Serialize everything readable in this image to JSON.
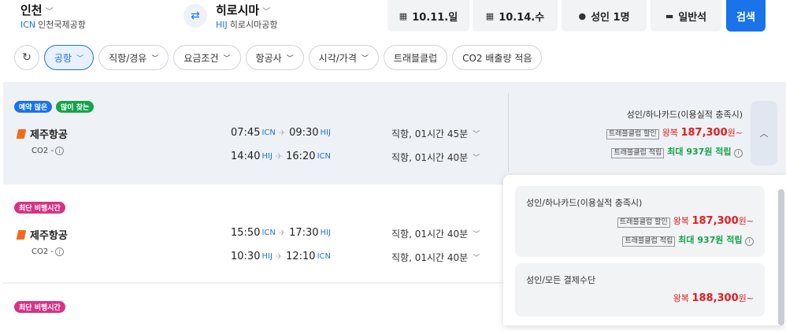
{
  "header": {
    "origin": {
      "city": "인천",
      "code": "ICN",
      "airport": "인천국제공항"
    },
    "destination": {
      "city": "히로시마",
      "code": "HIJ",
      "airport": "히로시마공항"
    },
    "depart_date": "10.11.일",
    "return_date": "10.14.수",
    "passengers": "성인 1명",
    "cabin": "일반석",
    "search_label": "검색"
  },
  "filters": [
    {
      "label": "공항"
    },
    {
      "label": "직항/경유"
    },
    {
      "label": "요금조건"
    },
    {
      "label": "항공사"
    },
    {
      "label": "시각/가격"
    },
    {
      "label": "트래블클럽"
    },
    {
      "label": "CO2 배출량 적음"
    }
  ],
  "results": [
    {
      "badges": [
        "예약 많은",
        "많이 찾는"
      ],
      "airline": "제주항공",
      "co2": "CO2 -",
      "segments": [
        {
          "dep_time": "07:45",
          "dep_code": "ICN",
          "arr_time": "09:30",
          "arr_code": "HIJ",
          "duration": "직항, 01시간 45분"
        },
        {
          "dep_time": "14:40",
          "dep_code": "HIJ",
          "arr_time": "16:20",
          "arr_code": "ICN",
          "duration": "직항, 01시간 40분"
        }
      ],
      "price": {
        "condition": "성인/하나카드(이용실적 충족시)",
        "discount_tag": "트래블클럽 할인",
        "round_trip": "왕복",
        "amount": "187,300",
        "unit": "원~",
        "points_tag": "트래블클럽 적립",
        "points": "최대 937원 적립"
      }
    },
    {
      "badges": [
        "최단 비행시간"
      ],
      "airline": "제주항공",
      "co2": "CO2 -",
      "segments": [
        {
          "dep_time": "15:50",
          "dep_code": "ICN",
          "arr_time": "17:30",
          "arr_code": "HIJ",
          "duration": "직항, 01시간 40분"
        },
        {
          "dep_time": "10:30",
          "dep_code": "HIJ",
          "arr_time": "12:10",
          "arr_code": "ICN",
          "duration": "직항, 01시간 40분"
        }
      ]
    },
    {
      "badges": [
        "최단 비행시간"
      ]
    }
  ],
  "fare_panel": [
    {
      "condition": "성인/하나카드(이용실적 충족시)",
      "discount_tag": "트래블클럽 할인",
      "round_trip": "왕복",
      "amount": "187,300",
      "unit": "원~",
      "points_tag": "트래블클럽 적립",
      "points": "최대 937원 적립"
    },
    {
      "condition": "성인/모든 결제수단",
      "round_trip": "왕복",
      "amount": "188,300",
      "unit": "원~"
    }
  ],
  "colors": {
    "accent": "#1a73e8",
    "price": "#e01e1e",
    "points": "#16a34a",
    "badge_blue": "#1a73e8",
    "badge_green": "#16a34a",
    "badge_pink": "#d63384"
  }
}
